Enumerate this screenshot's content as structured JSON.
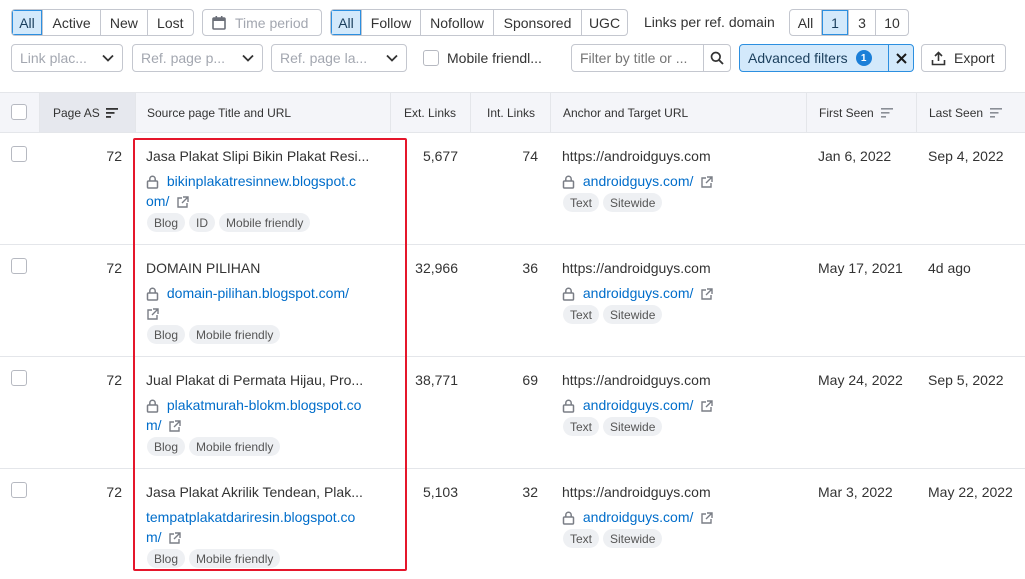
{
  "toolbar": {
    "status_tabs": [
      "All",
      "Active",
      "New",
      "Lost"
    ],
    "time_period_placeholder": "Time period",
    "type_tabs": [
      "All",
      "Follow",
      "Nofollow",
      "Sponsored",
      "UGC"
    ],
    "links_per_domain_label": "Links per ref. domain",
    "links_per_domain_tabs": [
      "All",
      "1",
      "3",
      "10"
    ]
  },
  "filters": {
    "link_placement": "Link plac...",
    "ref_page_platform": "Ref. page p...",
    "ref_page_language": "Ref. page la...",
    "mobile_friendly": "Mobile friendl...",
    "search_placeholder": "Filter by title or ...",
    "advanced_filters": "Advanced filters",
    "advanced_count": "1",
    "export": "Export"
  },
  "table": {
    "columns": {
      "page_as": "Page AS",
      "source": "Source page Title and URL",
      "ext_links": "Ext. Links",
      "int_links": "Int. Links",
      "anchor": "Anchor and Target URL",
      "first_seen": "First Seen",
      "last_seen": "Last Seen"
    },
    "rows": [
      {
        "page_as": "72",
        "title": "Jasa Plakat Slipi Bikin Plakat Resi...",
        "url_line1": "bikinplakatresinnew.blogspot.c",
        "url_line2": "om/",
        "tags": [
          "Blog",
          "ID",
          "Mobile friendly"
        ],
        "ext_links": "5,677",
        "int_links": "74",
        "anchor": "https://androidguys.com",
        "target": "androidguys.com/",
        "anchor_tags": [
          "Text",
          "Sitewide"
        ],
        "first_seen": "Jan 6, 2022",
        "last_seen": "Sep 4, 2022"
      },
      {
        "page_as": "72",
        "title": "DOMAIN PILIHAN",
        "url_line1": "domain-pilihan.blogspot.com/",
        "url_line2": "",
        "tags": [
          "Blog",
          "Mobile friendly"
        ],
        "ext_links": "32,966",
        "int_links": "36",
        "anchor": "https://androidguys.com",
        "target": "androidguys.com/",
        "anchor_tags": [
          "Text",
          "Sitewide"
        ],
        "first_seen": "May 17, 2021",
        "last_seen": "4d ago"
      },
      {
        "page_as": "72",
        "title": "Jual Plakat di Permata Hijau, Pro...",
        "url_line1": "plakatmurah-blokm.blogspot.co",
        "url_line2": "m/",
        "tags": [
          "Blog",
          "Mobile friendly"
        ],
        "ext_links": "38,771",
        "int_links": "69",
        "anchor": "https://androidguys.com",
        "target": "androidguys.com/",
        "anchor_tags": [
          "Text",
          "Sitewide"
        ],
        "first_seen": "May 24, 2022",
        "last_seen": "Sep 5, 2022"
      },
      {
        "page_as": "72",
        "title": "Jasa Plakat Akrilik Tendean, Plak...",
        "url_line1": "tempatplakatdariresin.blogspot.co",
        "url_line2": "m/",
        "tags": [
          "Blog",
          "Mobile friendly"
        ],
        "ext_links": "5,103",
        "int_links": "32",
        "anchor": "https://androidguys.com",
        "target": "androidguys.com/",
        "anchor_tags": [
          "Text",
          "Sitewide"
        ],
        "first_seen": "Mar 3, 2022",
        "last_seen": "May 22, 2022"
      }
    ]
  },
  "colors": {
    "accent": "#006dca",
    "active_tab_bg": "#d3e9fb",
    "highlight_box": "#e5162b"
  }
}
